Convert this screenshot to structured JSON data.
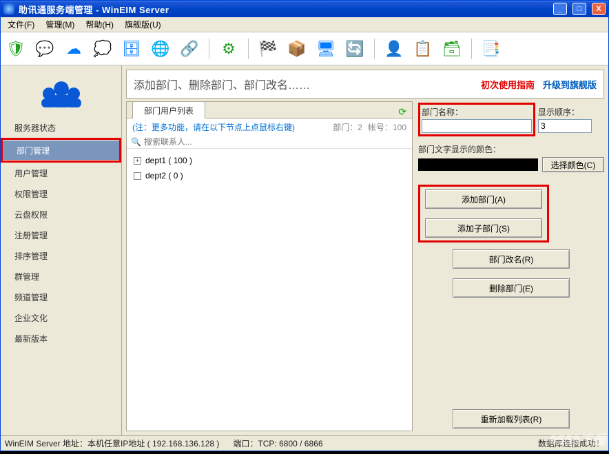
{
  "window": {
    "title": "助讯通服务端管理 - WinEIM Server"
  },
  "menubar": {
    "file": "文件(F)",
    "manage": "管理(M)",
    "help": "帮助(H)",
    "flagship": "旗舰版(U)"
  },
  "sidebar": {
    "items": [
      "服务器状态",
      "部门管理",
      "用户管理",
      "权限管理",
      "云盘权限",
      "注册管理",
      "排序管理",
      "群管理",
      "频道管理",
      "企业文化",
      "最新版本"
    ]
  },
  "header": {
    "title": "添加部门、删除部门、部门改名……",
    "link1": "初次使用指南",
    "link2": "升级到旗舰版"
  },
  "tabs": {
    "tab1": "部门用户列表"
  },
  "note": {
    "text": "(注：更多功能，请在以下节点上点鼠标右键)",
    "dept": "部门：2",
    "acct": "帐号：100"
  },
  "search": {
    "placeholder": "搜索联系人..."
  },
  "tree": {
    "n1": "dept1 ( 100 )",
    "n2": "dept2 ( 0 )"
  },
  "form": {
    "name_label": "部门名称：",
    "name_value": "",
    "order_label": "显示顺序：",
    "order_value": "3",
    "color_label": "部门文字显示的颜色：",
    "btn_color": "选择颜色(C)",
    "btn_add": "添加部门(A)",
    "btn_addsub": "添加子部门(S)",
    "btn_rename": "部门改名(R)",
    "btn_delete": "删除部门(E)",
    "btn_reload": "重新加载列表(R)"
  },
  "status": {
    "left": "WinEIM Server 地址：本机任意IP地址 ( 192.168.136.128 )",
    "mid": "端口：TCP: 6800 / 6866",
    "right": "数据库连接成功！"
  },
  "watermark": "9553下载"
}
